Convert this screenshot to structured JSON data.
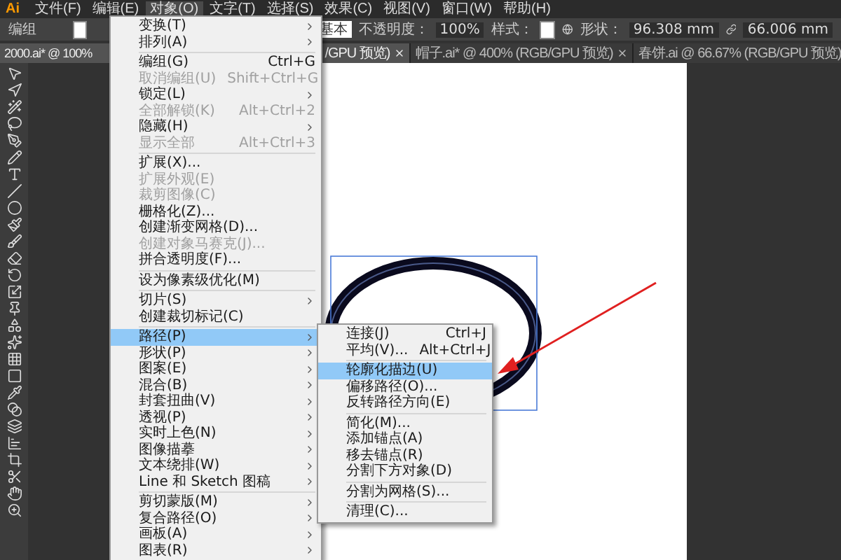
{
  "menubar": {
    "logo": "Ai",
    "items": [
      {
        "label": "文件(F)",
        "selected": false
      },
      {
        "label": "编辑(E)",
        "selected": false
      },
      {
        "label": "对象(O)",
        "selected": true
      },
      {
        "label": "文字(T)",
        "selected": false
      },
      {
        "label": "选择(S)",
        "selected": false
      },
      {
        "label": "效果(C)",
        "selected": false
      },
      {
        "label": "视图(V)",
        "selected": false
      },
      {
        "label": "窗口(W)",
        "selected": false
      },
      {
        "label": "帮助(H)",
        "selected": false
      }
    ]
  },
  "control_bar": {
    "selection_label": "编组",
    "stroke_profile": "基本",
    "opacity_label": "不透明度：",
    "opacity": "100%",
    "style_label": "样式：",
    "shape_label": "形状：",
    "width": "96.308 mm",
    "height": "66.006 mm"
  },
  "tabs": [
    {
      "label": "2000.ai* @ 100%",
      "label_end": "/GPU 预览)",
      "selected": true
    },
    {
      "label": "帽子.ai* @ 400% (RGB/GPU 预览)",
      "selected": false
    },
    {
      "label": "春饼.ai @ 66.67% (RGB/GPU 预览)",
      "selected": false
    }
  ],
  "object_menu": {
    "groups": [
      [
        {
          "label": "变换(T)",
          "submenu": true,
          "disabled": false,
          "selected": false
        },
        {
          "label": "排列(A)",
          "submenu": true,
          "disabled": false,
          "selected": false
        }
      ],
      [
        {
          "label": "编组(G)",
          "shortcut": "Ctrl+G",
          "submenu": false,
          "disabled": false,
          "selected": false
        },
        {
          "label": "取消编组(U)",
          "shortcut": "Shift+Ctrl+G",
          "submenu": false,
          "disabled": true,
          "selected": false
        },
        {
          "label": "锁定(L)",
          "submenu": true,
          "disabled": false,
          "selected": false
        },
        {
          "label": "全部解锁(K)",
          "shortcut": "Alt+Ctrl+2",
          "submenu": false,
          "disabled": true,
          "selected": false
        },
        {
          "label": "隐藏(H)",
          "submenu": true,
          "disabled": false,
          "selected": false
        },
        {
          "label": "显示全部",
          "shortcut": "Alt+Ctrl+3",
          "submenu": false,
          "disabled": true,
          "selected": false
        }
      ],
      [
        {
          "label": "扩展(X)...",
          "submenu": false,
          "disabled": false,
          "selected": false
        },
        {
          "label": "扩展外观(E)",
          "submenu": false,
          "disabled": true,
          "selected": false
        },
        {
          "label": "裁剪图像(C)",
          "submenu": false,
          "disabled": true,
          "selected": false
        },
        {
          "label": "栅格化(Z)...",
          "submenu": false,
          "disabled": false,
          "selected": false
        },
        {
          "label": "创建渐变网格(D)...",
          "submenu": false,
          "disabled": false,
          "selected": false
        },
        {
          "label": "创建对象马赛克(J)...",
          "submenu": false,
          "disabled": true,
          "selected": false
        },
        {
          "label": "拼合透明度(F)...",
          "submenu": false,
          "disabled": false,
          "selected": false
        }
      ],
      [
        {
          "label": "设为像素级优化(M)",
          "submenu": false,
          "disabled": false,
          "selected": false
        }
      ],
      [
        {
          "label": "切片(S)",
          "submenu": true,
          "disabled": false,
          "selected": false
        },
        {
          "label": "创建裁切标记(C)",
          "submenu": false,
          "disabled": false,
          "selected": false
        }
      ],
      [
        {
          "label": "路径(P)",
          "submenu": true,
          "disabled": false,
          "selected": true
        },
        {
          "label": "形状(P)",
          "submenu": true,
          "disabled": false,
          "selected": false
        },
        {
          "label": "图案(E)",
          "submenu": true,
          "disabled": false,
          "selected": false
        },
        {
          "label": "混合(B)",
          "submenu": true,
          "disabled": false,
          "selected": false
        },
        {
          "label": "封套扭曲(V)",
          "submenu": true,
          "disabled": false,
          "selected": false
        },
        {
          "label": "透视(P)",
          "submenu": true,
          "disabled": false,
          "selected": false
        },
        {
          "label": "实时上色(N)",
          "submenu": true,
          "disabled": false,
          "selected": false
        },
        {
          "label": "图像描摹",
          "submenu": true,
          "disabled": false,
          "selected": false
        },
        {
          "label": "文本绕排(W)",
          "submenu": true,
          "disabled": false,
          "selected": false
        },
        {
          "label": "Line 和 Sketch 图稿",
          "submenu": true,
          "disabled": false,
          "selected": false
        }
      ],
      [
        {
          "label": "剪切蒙版(M)",
          "submenu": true,
          "disabled": false,
          "selected": false
        },
        {
          "label": "复合路径(O)",
          "submenu": true,
          "disabled": false,
          "selected": false
        },
        {
          "label": "画板(A)",
          "submenu": true,
          "disabled": false,
          "selected": false
        },
        {
          "label": "图表(R)",
          "submenu": true,
          "disabled": false,
          "selected": false
        }
      ]
    ]
  },
  "path_submenu": {
    "groups": [
      [
        {
          "label": "连接(J)",
          "shortcut": "Ctrl+J",
          "disabled": false,
          "selected": false
        },
        {
          "label": "平均(V)...",
          "shortcut": "Alt+Ctrl+J",
          "disabled": false,
          "selected": false
        }
      ],
      [
        {
          "label": "轮廓化描边(U)",
          "disabled": false,
          "selected": true
        },
        {
          "label": "偏移路径(O)...",
          "disabled": false,
          "selected": false
        },
        {
          "label": "反转路径方向(E)",
          "disabled": false,
          "selected": false
        }
      ],
      [
        {
          "label": "简化(M)...",
          "disabled": false,
          "selected": false
        },
        {
          "label": "添加锚点(A)",
          "disabled": false,
          "selected": false
        },
        {
          "label": "移去锚点(R)",
          "disabled": false,
          "selected": false
        },
        {
          "label": "分割下方对象(D)",
          "disabled": false,
          "selected": false
        }
      ],
      [
        {
          "label": "分割为网格(S)...",
          "disabled": false,
          "selected": false
        }
      ],
      [
        {
          "label": "清理(C)...",
          "disabled": false,
          "selected": false
        }
      ]
    ]
  }
}
